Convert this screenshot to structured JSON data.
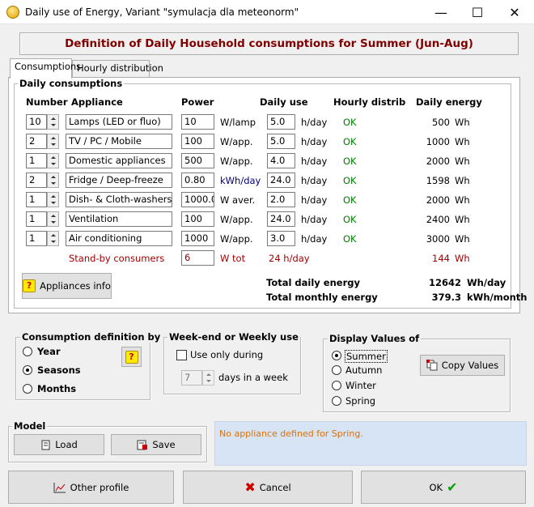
{
  "window": {
    "title": "Daily use of Energy, Variant  \"symulacja dla meteonorm\"",
    "minimize": "—",
    "maximize": "☐",
    "close": "✕"
  },
  "header": {
    "title": "Definition of Daily Household consumptions for Summer (Jun-Aug)"
  },
  "tabs": [
    {
      "label": "Consumptions"
    },
    {
      "label": "Hourly distribution"
    }
  ],
  "daily": {
    "group_label": "Daily consumptions",
    "columns": {
      "number": "Number",
      "appliance": "Appliance",
      "power": "Power",
      "daily_use": "Daily use",
      "hourly": "Hourly distrib",
      "energy": "Daily energy"
    },
    "rows": [
      {
        "number": "10",
        "appliance": "Lamps (LED or fluo)",
        "power": "10",
        "power_unit": "W/lamp",
        "use": "5.0",
        "use_unit": "h/day",
        "hourly": "OK",
        "energy": "500",
        "energy_unit": "Wh"
      },
      {
        "number": "2",
        "appliance": "TV / PC / Mobile",
        "power": "100",
        "power_unit": "W/app.",
        "use": "5.0",
        "use_unit": "h/day",
        "hourly": "OK",
        "energy": "1000",
        "energy_unit": "Wh"
      },
      {
        "number": "1",
        "appliance": "Domestic appliances",
        "power": "500",
        "power_unit": "W/app.",
        "use": "4.0",
        "use_unit": "h/day",
        "hourly": "OK",
        "energy": "2000",
        "energy_unit": "Wh"
      },
      {
        "number": "2",
        "appliance": "Fridge / Deep-freeze",
        "power": "0.80",
        "power_unit": "kWh/day",
        "use": "24.0",
        "use_unit": "h/day",
        "hourly": "OK",
        "energy": "1598",
        "energy_unit": "Wh"
      },
      {
        "number": "1",
        "appliance": "Dish- & Cloth-washers",
        "power": "1000.0",
        "power_unit": "W aver.",
        "use": "2.0",
        "use_unit": "h/day",
        "hourly": "OK",
        "energy": "2000",
        "energy_unit": "Wh"
      },
      {
        "number": "1",
        "appliance": "Ventilation",
        "power": "100",
        "power_unit": "W/app.",
        "use": "24.0",
        "use_unit": "h/day",
        "hourly": "OK",
        "energy": "2400",
        "energy_unit": "Wh"
      },
      {
        "number": "1",
        "appliance": "Air conditioning",
        "power": "1000",
        "power_unit": "W/app.",
        "use": "3.0",
        "use_unit": "h/day",
        "hourly": "OK",
        "energy": "3000",
        "energy_unit": "Wh"
      }
    ],
    "standby": {
      "label": "Stand-by consumers",
      "power": "6",
      "unit": "W tot",
      "use": "24 h/day",
      "energy": "144",
      "energy_unit": "Wh"
    },
    "appliances_info_button": "Appliances info",
    "total_daily": {
      "label": "Total daily energy",
      "value": "12642",
      "unit": "Wh/day"
    },
    "total_monthly": {
      "label": "Total monthly energy",
      "value": "379.3",
      "unit": "kWh/month"
    }
  },
  "consumption_def": {
    "label": "Consumption definition by",
    "options": [
      "Year",
      "Seasons",
      "Months"
    ],
    "selected": "Seasons"
  },
  "weekend": {
    "label": "Week-end or Weekly use",
    "checkbox_label": "Use only during",
    "days_value": "7",
    "days_label": "days in a week"
  },
  "display": {
    "label": "Display Values of",
    "options": [
      "Summer",
      "Autumn",
      "Winter",
      "Spring"
    ],
    "selected": "Summer",
    "copy_button": "Copy Values"
  },
  "model": {
    "label": "Model",
    "load_button": "Load",
    "save_button": "Save"
  },
  "message": "No appliance defined for Spring.",
  "footer": {
    "other_profile": "Other profile",
    "cancel": "Cancel",
    "ok": "OK"
  },
  "colors": {
    "header_text": "#800000",
    "ok_text": "#008000",
    "message_bg": "#d6e4f5",
    "message_text": "#e07000",
    "standby_text": "#a00000"
  }
}
